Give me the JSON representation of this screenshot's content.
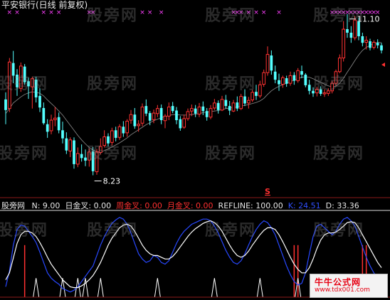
{
  "header": {
    "title": "平安银行(日线 前复权)"
  },
  "watermark": "股旁网",
  "indicator_bar": {
    "name": "股旁网",
    "params": [
      {
        "label": "N:",
        "value": "9.00",
        "color": "#e8e8e8"
      },
      {
        "label": "日金叉:",
        "value": "0.00",
        "color": "#e8e8e8"
      },
      {
        "label": "周金叉:",
        "value": "0.00",
        "color": "#ff3030"
      },
      {
        "label": "月金叉:",
        "value": "0.00",
        "color": "#ff3030"
      },
      {
        "label": "REFLINE:",
        "value": "100.00",
        "color": "#e8e8e8"
      },
      {
        "label": "K:",
        "value": "24.51",
        "color": "#3050ff"
      },
      {
        "label": "D:",
        "value": "33.36",
        "color": "#e8e8e8"
      }
    ]
  },
  "logo": {
    "line1": "牛牛公式网",
    "line2": "www.tdx001.com"
  },
  "colors": {
    "up": "#ff3232",
    "down": "#54ffff",
    "k_line": "#2848ff",
    "d_line": "#ffffff",
    "marker": "#ff40ff",
    "signal": "#ffffff"
  },
  "chart_data": [
    {
      "type": "candlestick",
      "series_name": "平安银行(日线 前复权)",
      "annotations": {
        "low_label": "8.23",
        "high_label": "11.10",
        "s_marker": "S"
      },
      "ylim": [
        7.9,
        11.5
      ],
      "ohlc": [
        [
          9.73,
          9.87,
          9.24,
          9.52
        ],
        [
          9.55,
          10.55,
          9.48,
          10.47
        ],
        [
          10.45,
          10.69,
          10.05,
          10.2
        ],
        [
          10.22,
          10.33,
          9.8,
          9.97
        ],
        [
          9.95,
          10.46,
          9.88,
          10.39
        ],
        [
          10.38,
          10.43,
          10.02,
          10.07
        ],
        [
          10.09,
          10.16,
          9.74,
          9.99
        ],
        [
          9.98,
          10.18,
          9.55,
          10.14
        ],
        [
          10.12,
          10.18,
          9.67,
          9.77
        ],
        [
          9.8,
          9.95,
          9.48,
          9.57
        ],
        [
          9.56,
          9.67,
          9.23,
          9.26
        ],
        [
          9.24,
          9.34,
          8.97,
          9.09
        ],
        [
          9.11,
          9.43,
          9.04,
          9.32
        ],
        [
          9.33,
          9.58,
          9.2,
          9.36
        ],
        [
          9.38,
          9.47,
          9.06,
          9.12
        ],
        [
          9.12,
          9.29,
          8.86,
          8.96
        ],
        [
          8.96,
          9.08,
          8.65,
          8.72
        ],
        [
          8.71,
          8.98,
          8.59,
          8.93
        ],
        [
          8.92,
          8.98,
          8.36,
          8.45
        ],
        [
          8.45,
          8.78,
          8.39,
          8.66
        ],
        [
          8.65,
          8.84,
          8.5,
          8.57
        ],
        [
          8.58,
          8.74,
          8.41,
          8.52
        ],
        [
          8.53,
          8.76,
          8.4,
          8.69
        ],
        [
          8.7,
          8.79,
          8.23,
          8.31
        ],
        [
          8.3,
          8.75,
          8.24,
          8.69
        ],
        [
          8.68,
          8.96,
          8.64,
          8.8
        ],
        [
          8.82,
          9.12,
          8.78,
          8.99
        ],
        [
          9.0,
          9.06,
          8.8,
          8.86
        ],
        [
          8.88,
          9.17,
          8.82,
          9.11
        ],
        [
          9.12,
          9.19,
          8.9,
          8.97
        ],
        [
          8.98,
          9.24,
          8.93,
          9.19
        ],
        [
          9.19,
          9.3,
          8.99,
          9.06
        ],
        [
          9.07,
          9.34,
          8.99,
          9.3
        ],
        [
          9.32,
          9.52,
          9.25,
          9.43
        ],
        [
          9.43,
          9.56,
          9.15,
          9.2
        ],
        [
          9.21,
          9.32,
          9.09,
          9.24
        ],
        [
          9.26,
          9.65,
          9.2,
          9.58
        ],
        [
          9.6,
          9.73,
          9.4,
          9.45
        ],
        [
          9.46,
          9.5,
          9.22,
          9.31
        ],
        [
          9.33,
          9.53,
          9.26,
          9.46
        ],
        [
          9.45,
          9.62,
          9.38,
          9.55
        ],
        [
          9.56,
          9.63,
          9.24,
          9.32
        ],
        [
          9.31,
          9.44,
          9.16,
          9.4
        ],
        [
          9.4,
          9.67,
          9.32,
          9.58
        ],
        [
          9.6,
          9.68,
          9.46,
          9.5
        ],
        [
          9.51,
          9.58,
          9.24,
          9.32
        ],
        [
          9.34,
          9.4,
          9.11,
          9.16
        ],
        [
          9.18,
          9.43,
          9.15,
          9.35
        ],
        [
          9.35,
          9.55,
          9.31,
          9.49
        ],
        [
          9.5,
          9.63,
          9.4,
          9.55
        ],
        [
          9.55,
          9.62,
          9.38,
          9.45
        ],
        [
          9.44,
          9.66,
          9.38,
          9.58
        ],
        [
          9.59,
          9.69,
          9.42,
          9.5
        ],
        [
          9.5,
          9.56,
          9.31,
          9.38
        ],
        [
          9.38,
          9.62,
          9.34,
          9.55
        ],
        [
          9.56,
          9.74,
          9.52,
          9.66
        ],
        [
          9.66,
          9.71,
          9.45,
          9.52
        ],
        [
          9.52,
          9.8,
          9.5,
          9.73
        ],
        [
          9.72,
          9.82,
          9.55,
          9.6
        ],
        [
          9.6,
          9.7,
          9.42,
          9.51
        ],
        [
          9.5,
          9.72,
          9.48,
          9.66
        ],
        [
          9.67,
          9.79,
          9.5,
          9.55
        ],
        [
          9.55,
          9.84,
          9.52,
          9.79
        ],
        [
          9.79,
          9.93,
          9.6,
          9.65
        ],
        [
          9.66,
          9.78,
          9.55,
          9.71
        ],
        [
          9.72,
          9.92,
          9.68,
          9.87
        ],
        [
          9.88,
          10.02,
          9.72,
          9.8
        ],
        [
          9.8,
          10.1,
          9.76,
          10.02
        ],
        [
          10.03,
          10.32,
          9.98,
          10.26
        ],
        [
          10.26,
          10.78,
          10.2,
          10.62
        ],
        [
          10.6,
          10.7,
          10.22,
          10.3
        ],
        [
          10.28,
          10.4,
          10.05,
          10.12
        ],
        [
          10.11,
          10.24,
          9.9,
          10.03
        ],
        [
          10.03,
          10.2,
          9.96,
          10.16
        ],
        [
          10.15,
          10.2,
          9.98,
          10.04
        ],
        [
          10.05,
          10.28,
          10.0,
          10.2
        ],
        [
          10.21,
          10.27,
          10.02,
          10.1
        ],
        [
          10.1,
          10.35,
          10.06,
          10.3
        ],
        [
          10.29,
          10.4,
          10.15,
          10.22
        ],
        [
          10.22,
          10.25,
          9.97,
          10.01
        ],
        [
          10.02,
          10.12,
          9.83,
          9.9
        ],
        [
          9.9,
          9.97,
          9.78,
          9.85
        ],
        [
          9.86,
          9.98,
          9.79,
          9.93
        ],
        [
          9.93,
          9.99,
          9.8,
          9.84
        ],
        [
          9.84,
          9.93,
          9.78,
          9.86
        ],
        [
          9.85,
          9.95,
          9.8,
          9.9
        ],
        [
          9.9,
          10.1,
          9.85,
          10.05
        ],
        [
          10.05,
          10.32,
          10.0,
          10.28
        ],
        [
          10.28,
          10.62,
          10.25,
          10.55
        ],
        [
          10.55,
          11.28,
          10.48,
          11.12
        ],
        [
          11.12,
          11.42,
          10.95,
          11.05
        ],
        [
          11.05,
          11.18,
          10.85,
          10.95
        ],
        [
          10.95,
          11.38,
          10.9,
          11.3
        ],
        [
          11.28,
          11.35,
          10.9,
          10.98
        ],
        [
          10.98,
          11.05,
          10.78,
          10.85
        ],
        [
          10.86,
          10.98,
          10.72,
          10.9
        ],
        [
          10.88,
          10.93,
          10.7,
          10.75
        ],
        [
          10.76,
          10.9,
          10.72,
          10.86
        ],
        [
          10.85,
          10.92,
          10.74,
          10.8
        ],
        [
          10.8,
          10.85,
          10.64,
          10.7
        ]
      ],
      "moving_average": [
        9.45,
        9.55,
        9.66,
        9.72,
        9.78,
        9.83,
        9.86,
        9.88,
        9.87,
        9.85,
        9.8,
        9.72,
        9.65,
        9.58,
        9.5,
        9.42,
        9.32,
        9.22,
        9.12,
        9.02,
        8.93,
        8.85,
        8.78,
        8.73,
        8.7,
        8.69,
        8.72,
        8.75,
        8.79,
        8.83,
        8.87,
        8.92,
        8.97,
        9.03,
        9.08,
        9.13,
        9.18,
        9.23,
        9.27,
        9.31,
        9.34,
        9.37,
        9.39,
        9.41,
        9.43,
        9.43,
        9.42,
        9.42,
        9.42,
        9.43,
        9.44,
        9.45,
        9.47,
        9.48,
        9.49,
        9.5,
        9.51,
        9.53,
        9.55,
        9.56,
        9.57,
        9.58,
        9.6,
        9.61,
        9.63,
        9.65,
        9.67,
        9.7,
        9.75,
        9.83,
        9.9,
        9.95,
        9.99,
        10.02,
        10.05,
        10.08,
        10.11,
        10.14,
        10.17,
        10.18,
        10.17,
        10.14,
        10.1,
        10.07,
        10.03,
        10.0,
        9.98,
        9.99,
        10.05,
        10.15,
        10.27,
        10.38,
        10.5,
        10.61,
        10.7,
        10.76,
        10.8,
        10.83,
        10.86,
        10.85
      ],
      "top_markers": [
        1,
        3,
        10,
        12,
        14,
        22,
        23,
        36,
        38,
        41,
        60,
        61,
        62,
        64,
        66,
        68,
        72,
        86,
        87,
        88,
        89,
        90,
        91,
        92,
        93,
        94,
        95,
        96,
        97,
        98
      ]
    },
    {
      "type": "line",
      "ylim": [
        0,
        100
      ],
      "series": [
        {
          "name": "K",
          "values": [
            12,
            30,
            60,
            78,
            83,
            82,
            76,
            70,
            63,
            52,
            40,
            28,
            22,
            18,
            15,
            10,
            8,
            6,
            8,
            12,
            18,
            24,
            30,
            36,
            48,
            60,
            70,
            78,
            85,
            89,
            92,
            90,
            84,
            74,
            62,
            50,
            44,
            40,
            42,
            48,
            46,
            40,
            38,
            42,
            52,
            62,
            70,
            76,
            80,
            84,
            86,
            88,
            90,
            90,
            88,
            82,
            74,
            64,
            54,
            46,
            40,
            38,
            42,
            50,
            60,
            70,
            78,
            84,
            88,
            86,
            80,
            72,
            60,
            48,
            36,
            26,
            18,
            14,
            16,
            28,
            50,
            70,
            82,
            84,
            80,
            76,
            72,
            76,
            84,
            90,
            92,
            88,
            82,
            70,
            58,
            46,
            36,
            28,
            22,
            24
          ]
        },
        {
          "name": "D",
          "values": [
            20,
            28,
            45,
            62,
            72,
            76,
            76,
            74,
            70,
            63,
            55,
            46,
            38,
            32,
            26,
            20,
            16,
            12,
            11,
            11,
            13,
            16,
            20,
            25,
            32,
            40,
            50,
            60,
            68,
            74,
            80,
            83,
            84,
            82,
            76,
            68,
            60,
            54,
            50,
            48,
            48,
            46,
            44,
            44,
            47,
            52,
            58,
            64,
            70,
            75,
            79,
            82,
            85,
            87,
            88,
            86,
            82,
            76,
            68,
            60,
            53,
            48,
            46,
            48,
            53,
            60,
            66,
            72,
            77,
            80,
            80,
            78,
            72,
            64,
            55,
            46,
            38,
            32,
            28,
            28,
            34,
            44,
            56,
            66,
            72,
            74,
            74,
            75,
            78,
            82,
            86,
            87,
            86,
            80,
            72,
            64,
            56,
            48,
            40,
            34
          ]
        }
      ],
      "refline": 100,
      "signal_spikes": [
        8,
        15,
        19,
        21,
        25,
        40,
        55,
        67,
        77,
        84,
        97
      ],
      "red_bars": [
        5,
        76,
        77,
        94,
        95
      ]
    }
  ]
}
